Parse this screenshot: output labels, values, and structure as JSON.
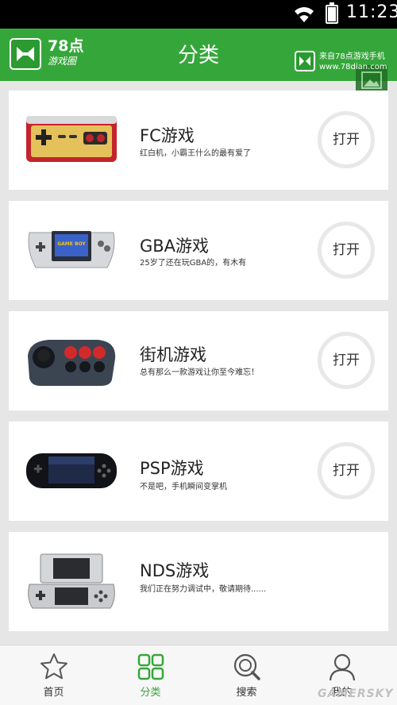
{
  "status_bar": {
    "time": "11:23",
    "battery_level": 1.0
  },
  "header": {
    "logo_number": "78点",
    "logo_subtitle": "游戏圈",
    "title": "分类",
    "watermark_line1": "来自78点游戏手机",
    "watermark_line2": "www.78dian.com"
  },
  "categories": [
    {
      "title": "FC游戏",
      "desc": "红白机，小霸王什么的最有爱了",
      "button": "打开",
      "thumb": "famicom-controller-image"
    },
    {
      "title": "GBA游戏",
      "desc": "25岁了还在玩GBA的，有木有",
      "button": "打开",
      "thumb": "game-boy-advance-image",
      "screen_text": "GAME BOY"
    },
    {
      "title": "街机游戏",
      "desc": "总有那么一款游戏让你至今难忘！",
      "button": "打开",
      "thumb": "arcade-stick-image"
    },
    {
      "title": "PSP游戏",
      "desc": "不是吧，手机瞬间变掌机",
      "button": "打开",
      "thumb": "psp-console-image"
    },
    {
      "title": "NDS游戏",
      "desc": "我们正在努力调试中，敬请期待......",
      "thumb": "nintendo-ds-image"
    }
  ],
  "tabbar": {
    "active": "分类",
    "tabs": [
      {
        "label": "首页",
        "icon": "star-icon"
      },
      {
        "label": "分类",
        "icon": "grid-icon"
      },
      {
        "label": "搜索",
        "icon": "search-icon"
      },
      {
        "label": "我的",
        "icon": "user-icon"
      }
    ]
  },
  "watermark": "GAMERSKY",
  "colors": {
    "brand_green": "#35a73a",
    "background": "#e6e6e6",
    "status_bar": "#000000"
  }
}
